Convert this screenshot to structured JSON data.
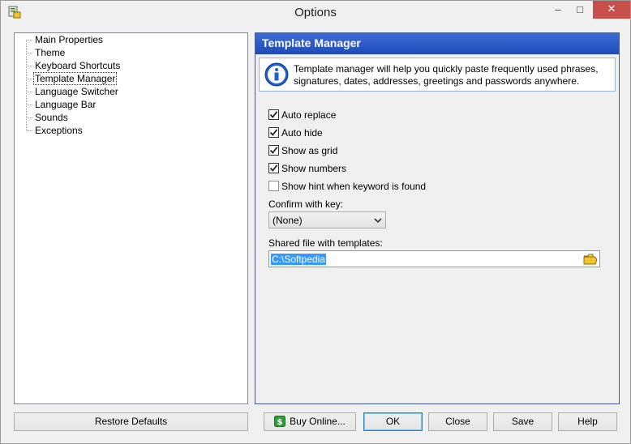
{
  "window": {
    "title": "Options",
    "app_icon": "options-app-icon",
    "controls": {
      "minimize": "–",
      "maximize": "□",
      "close": "✕"
    }
  },
  "tree": {
    "items": [
      {
        "label": "Main Properties"
      },
      {
        "label": "Theme"
      },
      {
        "label": "Keyboard Shortcuts"
      },
      {
        "label": "Template Manager",
        "selected": true
      },
      {
        "label": "Language Switcher"
      },
      {
        "label": "Language Bar"
      },
      {
        "label": "Sounds"
      },
      {
        "label": "Exceptions"
      }
    ]
  },
  "panel": {
    "header": "Template Manager",
    "info_line1": "Template manager will help you quickly paste frequently used phrases,",
    "info_line2": "signatures, dates, addresses, greetings and passwords anywhere.",
    "checkboxes": [
      {
        "label": "Auto replace",
        "checked": true
      },
      {
        "label": "Auto hide",
        "checked": true
      },
      {
        "label": "Show as grid",
        "checked": true
      },
      {
        "label": "Show numbers",
        "checked": true
      },
      {
        "label": "Show hint when keyword is found",
        "checked": false
      }
    ],
    "confirm_label": "Confirm with key:",
    "confirm_value": "(None)",
    "shared_file_label": "Shared file with templates:",
    "shared_file_value": "C:\\Softpedia"
  },
  "buttons": {
    "restore_defaults": "Restore Defaults",
    "buy_online": "Buy Online...",
    "ok": "OK",
    "close": "Close",
    "save": "Save",
    "help": "Help"
  },
  "colors": {
    "header_blue": "#2a57c8",
    "selection_blue": "#3399ff",
    "close_red": "#c7504a"
  }
}
